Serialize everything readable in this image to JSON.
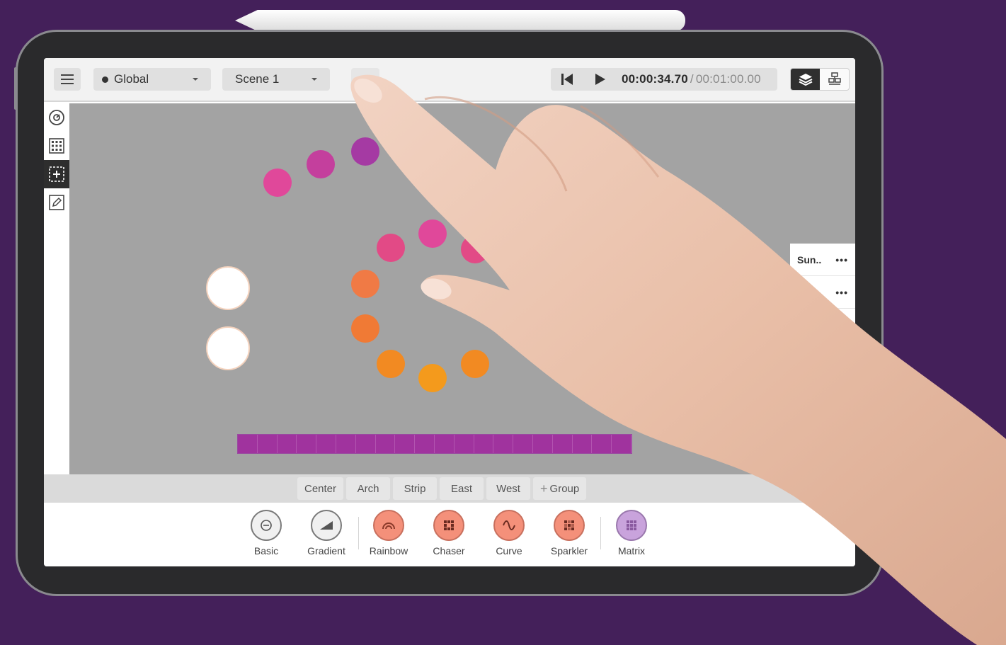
{
  "topbar": {
    "global_dropdown": "Global",
    "scene_dropdown": "Scene 1",
    "time_current": "00:00:34.70",
    "time_separator": "/",
    "time_total": "00:01:00.00"
  },
  "groups": {
    "tabs": [
      "Center",
      "Arch",
      "Strip",
      "East",
      "West"
    ],
    "add_label": "Group"
  },
  "effects": [
    "Basic",
    "Gradient",
    "Rainbow",
    "Chaser",
    "Curve",
    "Sparkler",
    "Matrix"
  ],
  "side_panel": {
    "rows": [
      {
        "label": "Sun..",
        "menu": "•••"
      },
      {
        "label": "",
        "menu": "•••"
      }
    ]
  },
  "colors": {
    "background": "#44205a",
    "canvas": "#a3a3a3",
    "strip": "#a0339e",
    "effect_orange": "#f4907a",
    "effect_purple": "#c9a3dc",
    "fixtures": [
      "#a53aa3",
      "#c43f9d",
      "#e0489a",
      "#e24a86",
      "#e85a6a",
      "#f07a45",
      "#f28a22",
      "#f49a1c",
      "#ffffff"
    ]
  },
  "icons": [
    "menu-icon",
    "caret-down-icon",
    "skip-back-icon",
    "play-icon",
    "layers-icon",
    "fixtures-icon",
    "select-tool-icon",
    "grid-tool-icon",
    "add-fixture-icon",
    "edit-tool-icon",
    "basic-effect-icon",
    "gradient-effect-icon",
    "rainbow-effect-icon",
    "chaser-effect-icon",
    "curve-effect-icon",
    "sparkler-effect-icon",
    "matrix-effect-icon"
  ]
}
